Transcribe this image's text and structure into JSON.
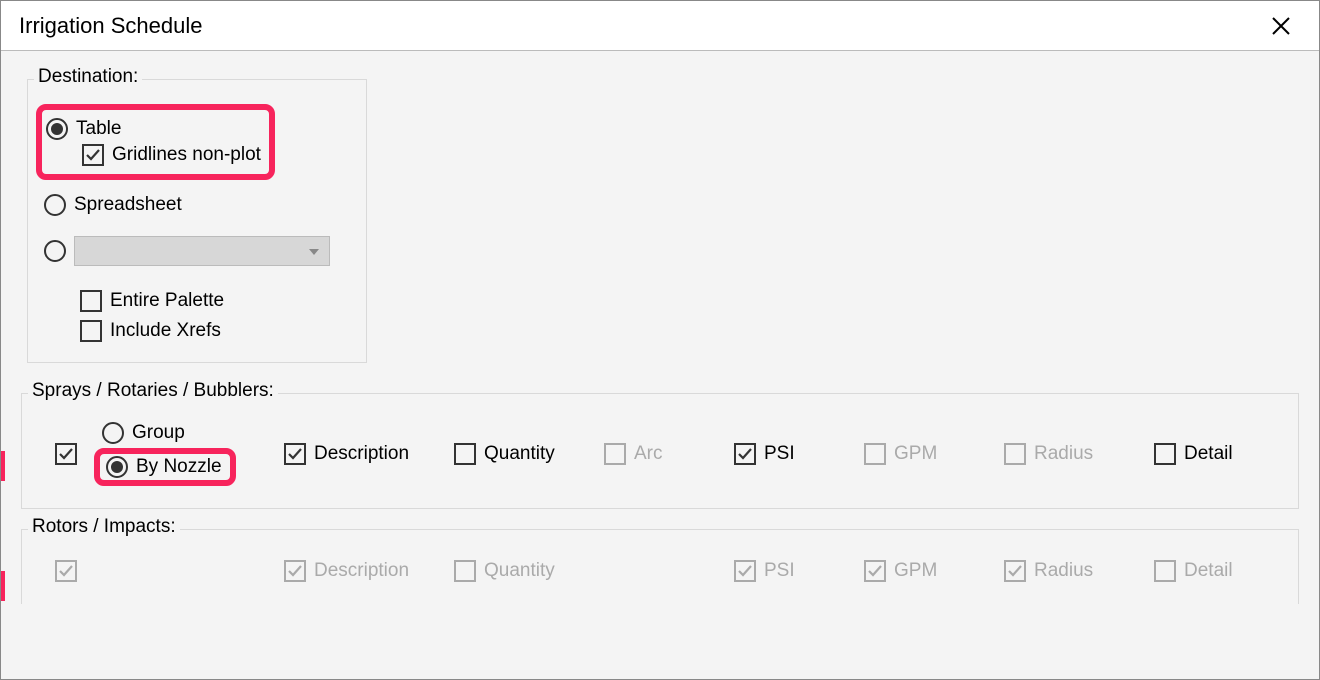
{
  "window": {
    "title": "Irrigation Schedule"
  },
  "destination": {
    "legend": "Destination:",
    "table": "Table",
    "gridlines": "Gridlines non-plot",
    "spreadsheet": "Spreadsheet",
    "entire_palette": "Entire Palette",
    "include_xrefs": "Include Xrefs"
  },
  "srb": {
    "legend": "Sprays / Rotaries / Bubblers:",
    "group": "Group",
    "by_nozzle": "By Nozzle",
    "description": "Description",
    "quantity": "Quantity",
    "arc": "Arc",
    "psi": "PSI",
    "gpm": "GPM",
    "radius": "Radius",
    "detail": "Detail"
  },
  "rotors": {
    "legend": "Rotors / Impacts:",
    "description": "Description",
    "quantity": "Quantity",
    "psi": "PSI",
    "gpm": "GPM",
    "radius": "Radius",
    "detail": "Detail"
  }
}
